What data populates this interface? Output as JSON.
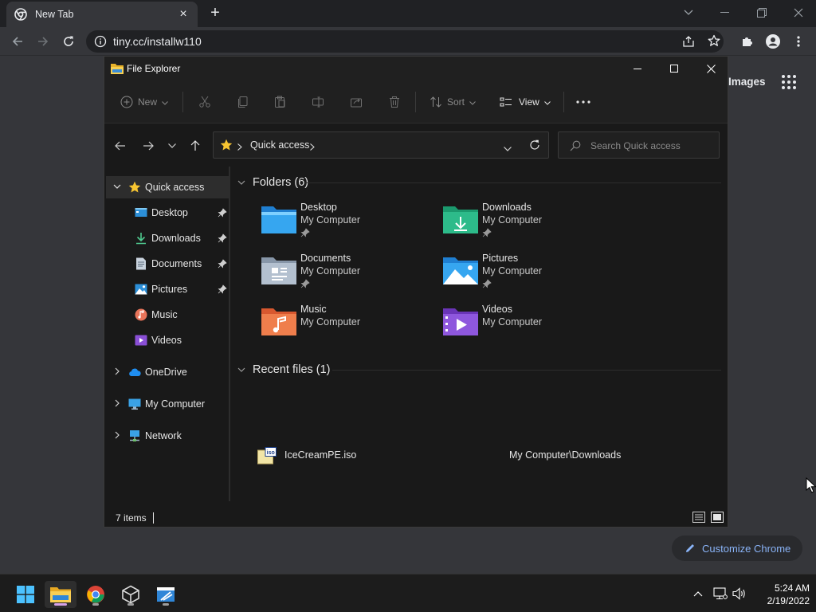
{
  "chrome": {
    "tab_title": "New Tab",
    "url": "tiny.cc/installw110",
    "ntp_images_link": "Images",
    "customize_label": "Customize Chrome",
    "accent": "#8ab4f8"
  },
  "explorer": {
    "title": "File Explorer",
    "commands": {
      "new_label": "New",
      "sort_label": "Sort",
      "view_label": "View"
    },
    "address": {
      "crumb": "Quick access"
    },
    "search": {
      "placeholder": "Search Quick access"
    },
    "nav": {
      "quick_access": "Quick access",
      "items": [
        {
          "label": "Desktop",
          "icon": "desktop-icon",
          "pinned": true
        },
        {
          "label": "Downloads",
          "icon": "downloads-icon",
          "pinned": true
        },
        {
          "label": "Documents",
          "icon": "documents-icon",
          "pinned": true
        },
        {
          "label": "Pictures",
          "icon": "pictures-icon",
          "pinned": true
        },
        {
          "label": "Music",
          "icon": "music-icon",
          "pinned": false
        },
        {
          "label": "Videos",
          "icon": "videos-icon",
          "pinned": false
        }
      ],
      "onedrive": "OneDrive",
      "my_computer": "My Computer",
      "network": "Network"
    },
    "folders_header": "Folders (6)",
    "folders": [
      {
        "name": "Desktop",
        "location": "My Computer",
        "pinned": true
      },
      {
        "name": "Downloads",
        "location": "My Computer",
        "pinned": true
      },
      {
        "name": "Documents",
        "location": "My Computer",
        "pinned": true
      },
      {
        "name": "Pictures",
        "location": "My Computer",
        "pinned": true
      },
      {
        "name": "Music",
        "location": "My Computer",
        "pinned": false
      },
      {
        "name": "Videos",
        "location": "My Computer",
        "pinned": false
      }
    ],
    "recent_header": "Recent files (1)",
    "recent": [
      {
        "name": "IceCreamPE.iso",
        "path": "My Computer\\Downloads",
        "icon_text": "iso"
      }
    ],
    "status": {
      "item_count": "7 items"
    }
  },
  "taskbar": {
    "time": "5:24 AM",
    "date": "2/19/2022"
  }
}
